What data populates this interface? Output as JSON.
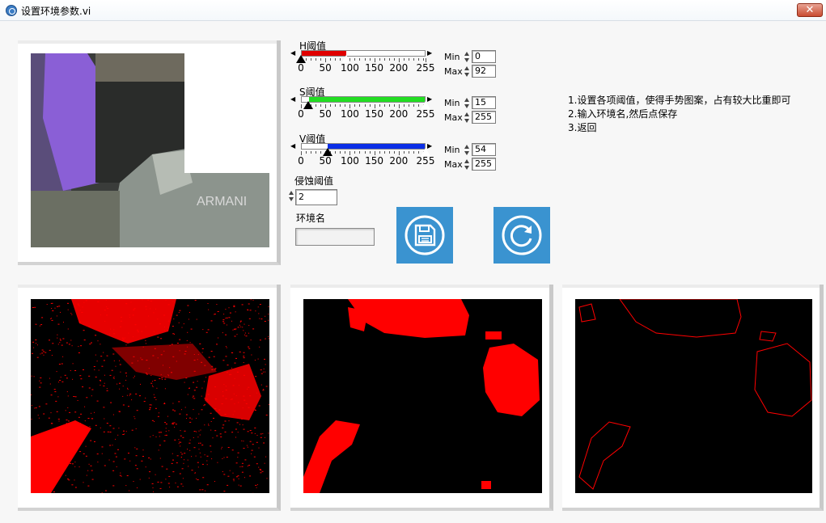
{
  "window": {
    "title": "设置环境参数.vi",
    "close_label": "✕"
  },
  "sliders": [
    {
      "label": "H阈值",
      "color": "#e00000",
      "min": 0,
      "max": 92,
      "scale_max": 255,
      "ticks": [
        "0",
        "50",
        "100",
        "150",
        "200",
        "255"
      ]
    },
    {
      "label": "S阈值",
      "color": "#22dd22",
      "min": 15,
      "max": 255,
      "scale_max": 255,
      "ticks": [
        "0",
        "50",
        "100",
        "150",
        "200",
        "255"
      ]
    },
    {
      "label": "V阈值",
      "color": "#0a2ee6",
      "min": 54,
      "max": 255,
      "scale_max": 255,
      "ticks": [
        "0",
        "50",
        "100",
        "150",
        "200",
        "255"
      ]
    }
  ],
  "min_label": "Min",
  "max_label": "Max",
  "erosion": {
    "label": "侵蚀阈值",
    "value": "2"
  },
  "env_name": {
    "label": "环境名",
    "value": ""
  },
  "buttons": {
    "save_icon": "save-disk-icon",
    "refresh_icon": "refresh-icon"
  },
  "instructions": [
    "1.设置各项阈值，使得手势图案，占有较大比重即可",
    "2.输入环境名,然后点保存",
    "3.返回"
  ],
  "colors": {
    "mask": "#ff0000",
    "button": "#3a93d0"
  }
}
